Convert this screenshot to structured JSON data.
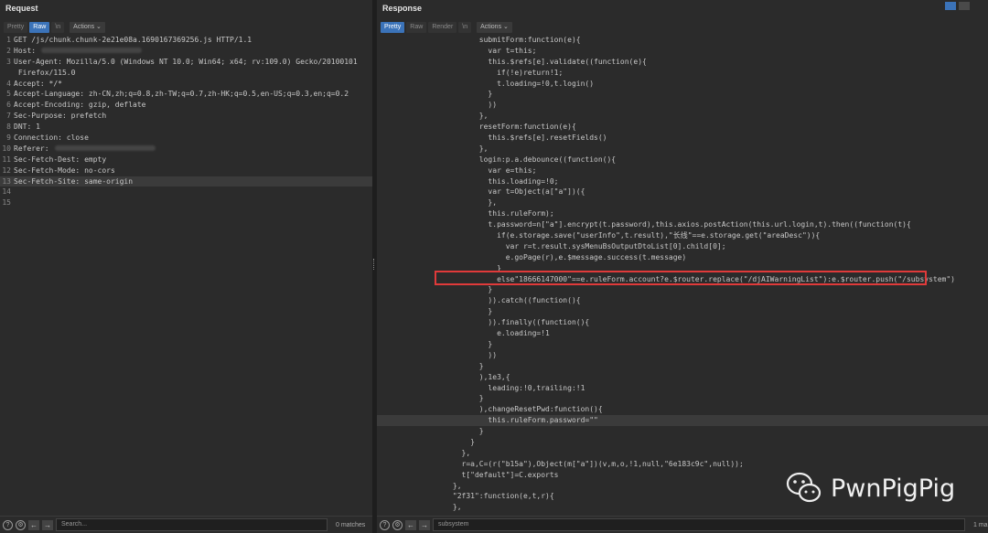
{
  "request": {
    "title": "Request",
    "tabs": [
      "Pretty",
      "Raw",
      "\\n",
      "Actions ⌄"
    ],
    "active_tab": "Raw",
    "lines": [
      "GET /js/chunk.chunk-2e21e08a.1690167369256.js HTTP/1.1",
      "Host:",
      "User-Agent: Mozilla/5.0 (Windows NT 10.0; Win64; x64; rv:109.0) Gecko/20100101",
      " Firefox/115.0",
      "Accept: */*",
      "Accept-Language: zh-CN,zh;q=0.8,zh-TW;q=0.7,zh-HK;q=0.5,en-US;q=0.3,en;q=0.2",
      "Accept-Encoding: gzip, deflate",
      "Sec-Purpose: prefetch",
      "DNT: 1",
      "Connection: close",
      "Referer:",
      "Sec-Fetch-Dest: empty",
      "Sec-Fetch-Mode: no-cors",
      "Sec-Fetch-Site: same-origin",
      "",
      ""
    ],
    "line_numbers": [
      "1",
      "2",
      "3",
      "",
      "4",
      "5",
      "6",
      "7",
      "8",
      "9",
      "10",
      "11",
      "12",
      "13",
      "14",
      "15"
    ],
    "search_placeholder": "Search...",
    "matches": "0 matches"
  },
  "response": {
    "title": "Response",
    "tabs": [
      "Pretty",
      "Raw",
      "Render",
      "\\n",
      "Actions ⌄"
    ],
    "active_tab": "Pretty",
    "lines": [
      "            submitForm:function(e){",
      "              var t=this;",
      "              this.$refs[e].validate((function(e){",
      "                if(!e)return!1;",
      "                t.loading=!0,t.login()",
      "              }",
      "              ))",
      "            },",
      "            resetForm:function(e){",
      "              this.$refs[e].resetFields()",
      "            },",
      "            login:p.a.debounce((function(){",
      "              var e=this;",
      "              this.loading=!0;",
      "              var t=Object(a[\"a\"])({",
      "              },",
      "              this.ruleForm);",
      "              t.password=n[\"a\"].encrypt(t.password),this.axios.postAction(this.url.login,t).then((function(t){",
      "                if(e.storage.save(\"userInfo\",t.result),\"长线\"==e.storage.get(\"areaDesc\")){",
      "                  var r=t.result.sysMenuBsOutputDtoList[0].child[0];",
      "                  e.goPage(r),e.$message.success(t.message)",
      "                }",
      "                else\"18666147000\"==e.ruleForm.account?e.$router.replace(\"/djAIWarningList\"):e.$router.push(\"/subsystem\")",
      "              }",
      "              )).catch((function(){",
      "              }",
      "              )).finally((function(){",
      "                e.loading=!1",
      "              }",
      "              ))",
      "            }",
      "            ),1e3,{",
      "              leading:!0,trailing:!1",
      "            }",
      "            ),changeResetPwd:function(){",
      "              this.ruleForm.password=\"\"",
      "            }",
      "          }",
      "        },",
      "        r=a,C=(r(\"b15a\"),Object(m[\"a\"])(v,m,o,!1,null,\"6e183c9c\",null));",
      "        t[\"default\"]=C.exports",
      "      },",
      "      \"2f31\":function(e,t,r){",
      "      },"
    ],
    "search_value": "subsystem",
    "matches": "1 ma"
  },
  "watermark": {
    "text": "PwnPigPig",
    "icon": "wechat-icon"
  },
  "colors": {
    "accent": "#3b73b9",
    "highlight_box": "#e03a3a"
  }
}
